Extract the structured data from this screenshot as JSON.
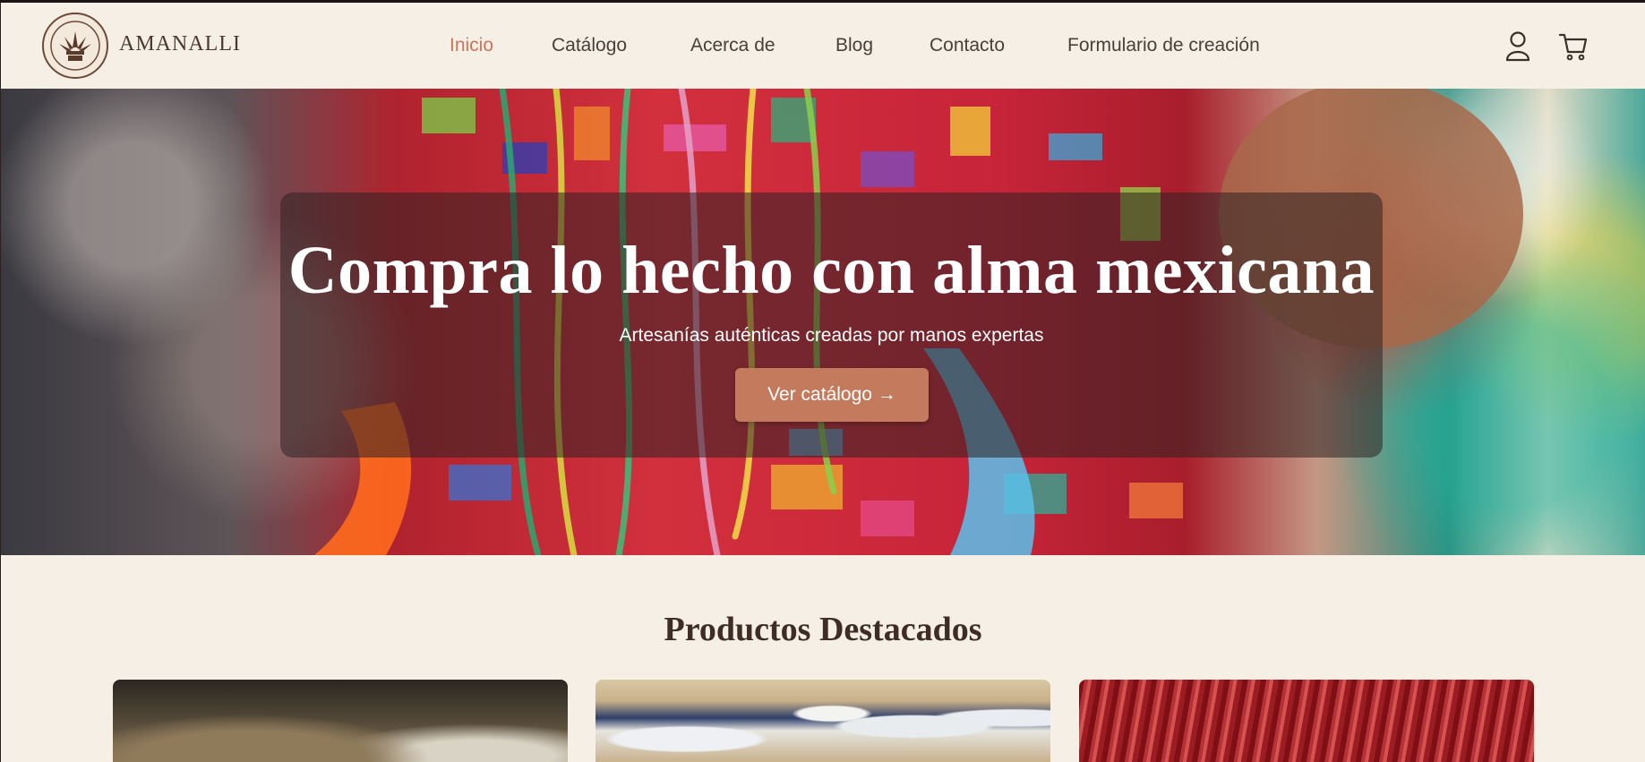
{
  "header": {
    "brand": "AMANALLI",
    "nav": [
      {
        "label": "Inicio",
        "active": true
      },
      {
        "label": "Catálogo",
        "active": false
      },
      {
        "label": "Acerca de",
        "active": false
      },
      {
        "label": "Blog",
        "active": false
      },
      {
        "label": "Contacto",
        "active": false
      },
      {
        "label": "Formulario de creación",
        "active": false
      }
    ],
    "icons": [
      "user-icon",
      "cart-icon"
    ]
  },
  "hero": {
    "title": "Compra lo hecho con alma mexicana",
    "subtitle": "Artesanías auténticas creadas por manos expertas",
    "button": "Ver catálogo →"
  },
  "featured": {
    "title": "Productos Destacados",
    "cards": 3
  },
  "colors": {
    "background": "#f6efe6",
    "accent": "#c8765a",
    "button": "#c47a5c",
    "text": "#4a3f38"
  }
}
